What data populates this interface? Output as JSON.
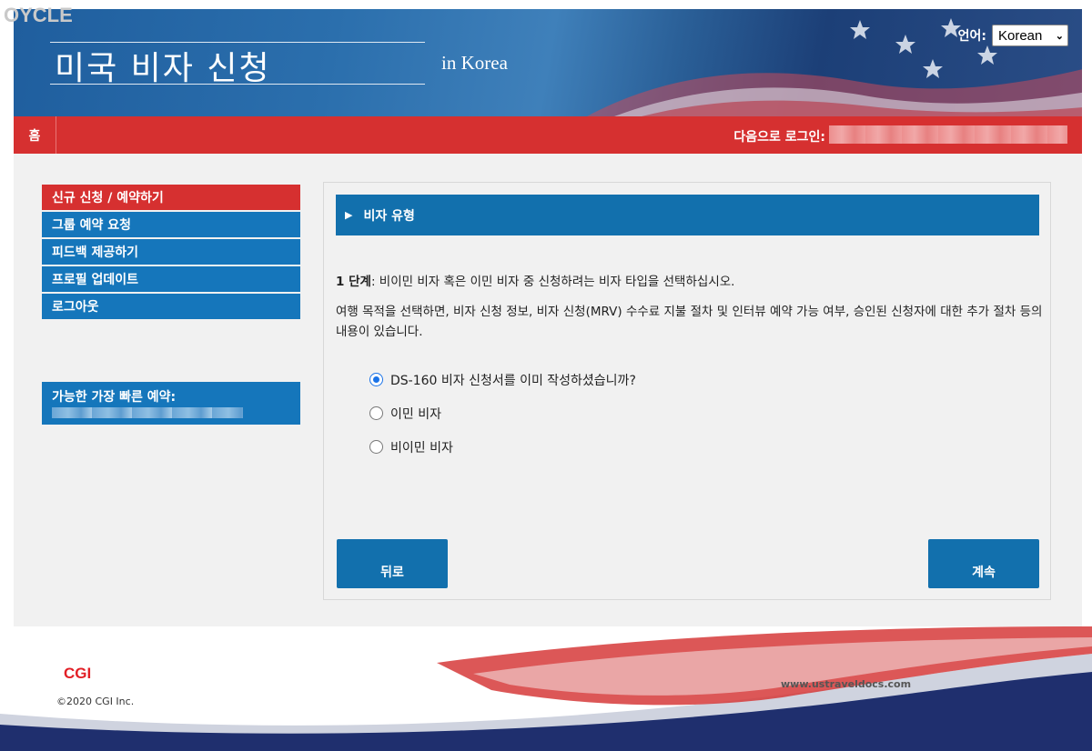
{
  "watermark": "OYCLE",
  "header": {
    "title": "미국 비자 신청",
    "subtitle": "in Korea",
    "language_label": "언어:",
    "language_value": "Korean"
  },
  "navbar": {
    "home": "홈",
    "login_label": "다음으로 로그인:"
  },
  "sidebar": {
    "items": [
      {
        "label": "신규 신청 / 예약하기",
        "active": true
      },
      {
        "label": "그룹 예약 요청",
        "active": false
      },
      {
        "label": "피드백 제공하기",
        "active": false
      },
      {
        "label": "프로필 업데이트",
        "active": false
      },
      {
        "label": "로그아웃",
        "active": false
      }
    ],
    "earliest_label": "가능한 가장 빠른 예약:"
  },
  "panel": {
    "title": "비자 유형",
    "step_label": "1 단계",
    "step_text": ": 비이민 비자 혹은 이민 비자 중 신청하려는 비자 타입을 선택하십시오.",
    "description": "여행 목적을 선택하면, 비자 신청 정보, 비자 신청(MRV) 수수료 지불 절차 및 인터뷰 예약 가능 여부, 승인된 신청자에 대한 추가 절차 등의 내용이 있습니다.",
    "options": [
      {
        "label": "DS-160 비자 신청서를 이미 작성하셨습니까?",
        "checked": true
      },
      {
        "label": "이민 비자",
        "checked": false
      },
      {
        "label": "비이민 비자",
        "checked": false
      }
    ],
    "back_label": "뒤로",
    "continue_label": "계속"
  },
  "footer": {
    "logo": "CGI",
    "copyright": "©2020 CGI Inc.",
    "site": "www.ustraveldocs.com"
  },
  "colors": {
    "nav_red": "#d63030",
    "accent_blue": "#1270ad",
    "sidebar_blue": "#1576bb"
  }
}
